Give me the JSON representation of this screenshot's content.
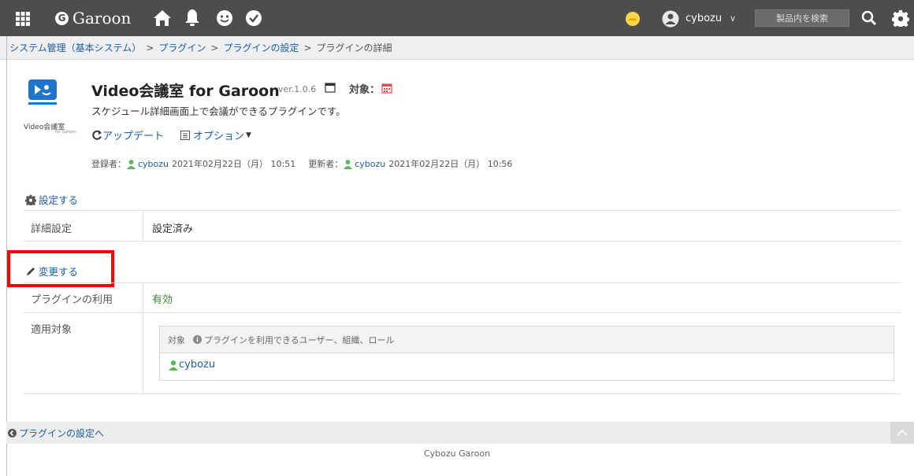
{
  "header": {
    "brand": "Garoon",
    "user_name": "cybozu",
    "search_placeholder": "製品内を検索",
    "icons": [
      "apps-grid-icon",
      "home-icon",
      "bell-icon",
      "smile-icon",
      "check-icon",
      "status-icon",
      "user-avatar-icon",
      "search-icon",
      "settings-gear-icon"
    ]
  },
  "breadcrumb": {
    "items": [
      "システム管理（基本システム）",
      "プラグイン",
      "プラグインの設定"
    ],
    "current": "プラグインの詳細",
    "separator": ">"
  },
  "plugin": {
    "logo_text": "Video会議室",
    "logo_sub": "for Garoon",
    "title": "Video会議室 for Garoon",
    "version": "ver.1.0.6",
    "target_label": "対象：",
    "description": "スケジュール詳細画面上で会議ができるプラグインです。",
    "update_label": "アップデート",
    "option_label": "オプション",
    "registered_label": "登録者：",
    "registered_user": "cybozu",
    "registered_date": "2021年02月22日（月） 10:51",
    "updated_label": "更新者：",
    "updated_user": "cybozu",
    "updated_date": "2021年02月22日（月） 10:56"
  },
  "settings_section": {
    "link": "設定する",
    "row_label": "詳細設定",
    "row_value": "設定済み"
  },
  "change_section": {
    "link": "変更する",
    "usage_label": "プラグインの利用",
    "usage_value": "有効",
    "scope_label": "適用対象",
    "scope_header": "対象",
    "scope_hint": "プラグインを利用できるユーザー、組織、ロール",
    "scope_user": "cybozu"
  },
  "footer": {
    "back_link": "プラグインの設定へ",
    "copyright": "Cybozu Garoon"
  },
  "colors": {
    "topbar": "#4d4d4d",
    "link": "#1b5da4",
    "highlight": "#ff0000",
    "enabled": "#3a8a3a"
  }
}
